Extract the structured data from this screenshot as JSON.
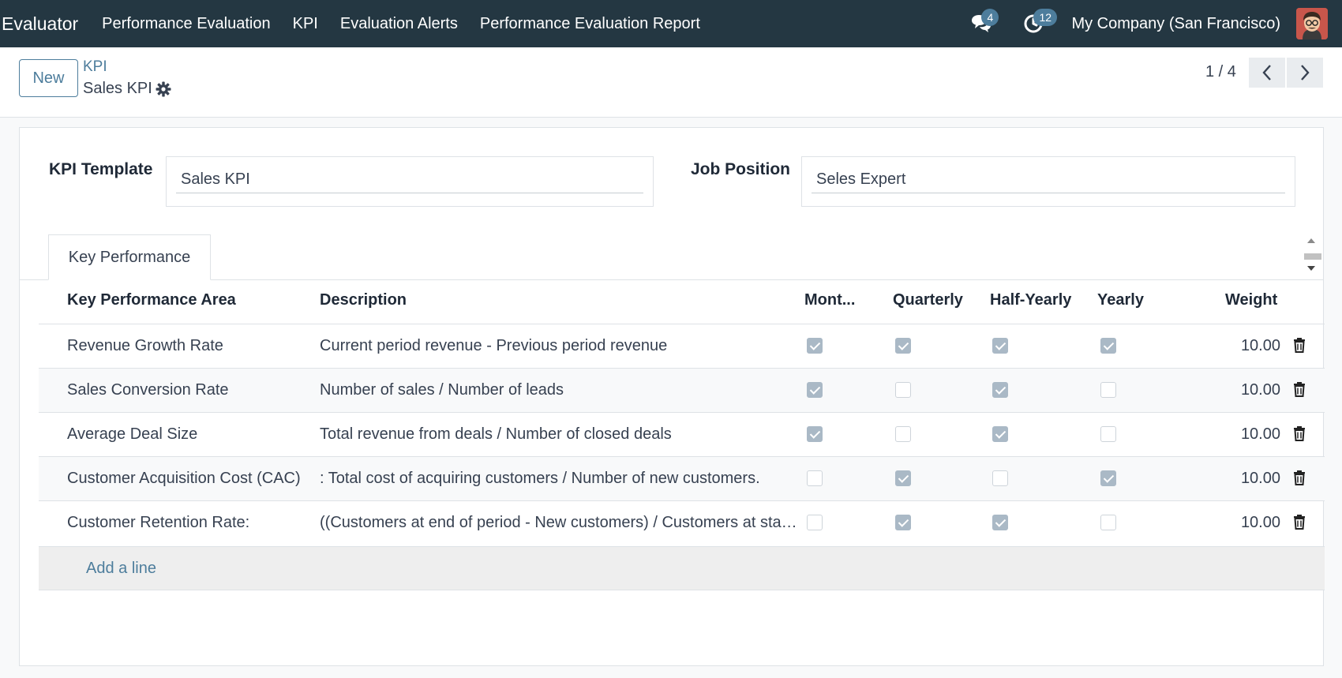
{
  "navbar": {
    "app_name": "Evaluator",
    "menu": [
      "Performance Evaluation",
      "KPI",
      "Evaluation Alerts",
      "Performance Evaluation Report"
    ],
    "messages_count": "4",
    "activities_count": "12",
    "company": "My Company (San Francisco)"
  },
  "control_panel": {
    "new_label": "New",
    "breadcrumb": "KPI",
    "record_name": "Sales KPI",
    "pager": "1 / 4"
  },
  "form": {
    "kpi_template_label": "KPI Template",
    "kpi_template_value": "Sales KPI",
    "job_position_label": "Job Position",
    "job_position_value": "Seles Expert"
  },
  "tab": {
    "label": "Key Performance"
  },
  "table": {
    "headers": [
      "Key Performance Area",
      "Description",
      "Mont...",
      "Quarterly",
      "Half-Yearly",
      "Yearly",
      "Weight"
    ],
    "rows": [
      {
        "area": "Revenue Growth Rate",
        "description": "Current period revenue - Previous period revenue",
        "monthly": true,
        "quarterly": true,
        "half_yearly": true,
        "yearly": true,
        "weight": "10.00"
      },
      {
        "area": "Sales Conversion Rate",
        "description": "Number of sales / Number of leads",
        "monthly": true,
        "quarterly": false,
        "half_yearly": true,
        "yearly": false,
        "weight": "10.00"
      },
      {
        "area": "Average Deal Size",
        "description": "Total revenue from deals / Number of closed deals",
        "monthly": true,
        "quarterly": false,
        "half_yearly": true,
        "yearly": false,
        "weight": "10.00"
      },
      {
        "area": "Customer Acquisition Cost (CAC)",
        "description": ": Total cost of acquiring customers / Number of new customers.",
        "monthly": false,
        "quarterly": true,
        "half_yearly": false,
        "yearly": true,
        "weight": "10.00"
      },
      {
        "area": "Customer Retention Rate:",
        "description": "((Customers at end of period - New customers) / Customers at start of period)",
        "monthly": false,
        "quarterly": true,
        "half_yearly": true,
        "yearly": false,
        "weight": "10.00"
      }
    ],
    "add_line_label": "Add a line"
  },
  "colors": {
    "navbar": "#243742",
    "accent": "#4d7d9c",
    "checkbox_checked": "#aab9c6"
  }
}
